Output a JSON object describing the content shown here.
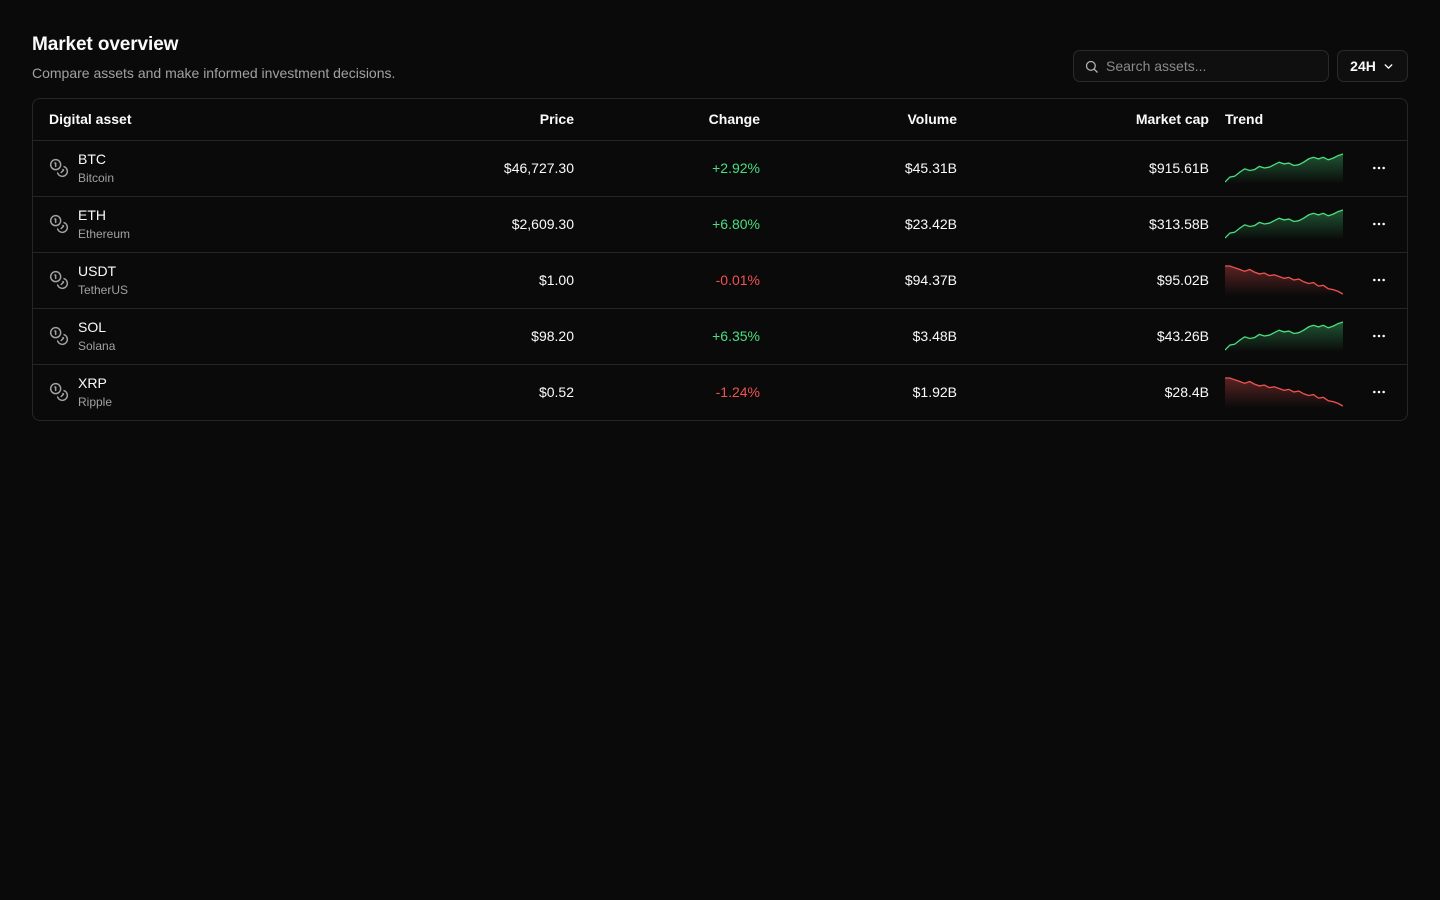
{
  "header": {
    "title": "Market overview",
    "subtitle": "Compare assets and make informed investment decisions."
  },
  "search": {
    "placeholder": "Search assets...",
    "icon": "search-icon"
  },
  "range_selector": {
    "value": "24H",
    "icon": "chevron-down-icon"
  },
  "table": {
    "columns": [
      "Digital asset",
      "Price",
      "Change",
      "Volume",
      "Market cap",
      "Trend"
    ],
    "rows": [
      {
        "symbol": "BTC",
        "name": "Bitcoin",
        "price": "$46,727.30",
        "change": "+2.92%",
        "direction": "up",
        "volume": "$45.31B",
        "market_cap": "$915.61B",
        "trend": [
          10,
          16,
          17,
          22,
          26,
          24,
          25,
          29,
          27,
          28,
          31,
          34,
          32,
          33,
          30,
          31,
          34,
          38,
          40,
          38,
          40,
          37,
          39,
          42,
          44
        ]
      },
      {
        "symbol": "ETH",
        "name": "Ethereum",
        "price": "$2,609.30",
        "change": "+6.80%",
        "direction": "up",
        "volume": "$23.42B",
        "market_cap": "$313.58B",
        "trend": [
          10,
          16,
          17,
          22,
          26,
          24,
          25,
          29,
          27,
          28,
          31,
          34,
          32,
          33,
          30,
          31,
          34,
          38,
          40,
          38,
          40,
          37,
          39,
          42,
          44
        ]
      },
      {
        "symbol": "USDT",
        "name": "TetherUS",
        "price": "$1.00",
        "change": "-0.01%",
        "direction": "down",
        "volume": "$94.37B",
        "market_cap": "$95.02B",
        "trend": [
          44,
          44,
          42,
          40,
          38,
          40,
          37,
          35,
          36,
          33,
          34,
          32,
          30,
          31,
          28,
          29,
          26,
          24,
          25,
          21,
          22,
          18,
          17,
          15,
          12
        ]
      },
      {
        "symbol": "SOL",
        "name": "Solana",
        "price": "$98.20",
        "change": "+6.35%",
        "direction": "up",
        "volume": "$3.48B",
        "market_cap": "$43.26B",
        "trend": [
          10,
          16,
          17,
          22,
          26,
          24,
          25,
          29,
          27,
          28,
          31,
          34,
          32,
          33,
          30,
          31,
          34,
          38,
          40,
          38,
          40,
          37,
          39,
          42,
          44
        ]
      },
      {
        "symbol": "XRP",
        "name": "Ripple",
        "price": "$0.52",
        "change": "-1.24%",
        "direction": "down",
        "volume": "$1.92B",
        "market_cap": "$28.4B",
        "trend": [
          44,
          44,
          42,
          40,
          38,
          40,
          37,
          35,
          36,
          33,
          34,
          32,
          30,
          31,
          28,
          29,
          26,
          24,
          25,
          21,
          22,
          18,
          17,
          15,
          12
        ]
      }
    ],
    "row_icon": "coins-icon",
    "row_action_icon": "more-horizontal-icon"
  },
  "colors": {
    "background": "#0a0a0a",
    "border": "#262626",
    "positive": "#4ade80",
    "negative": "#f05252",
    "muted_text": "#a1a1a1"
  }
}
